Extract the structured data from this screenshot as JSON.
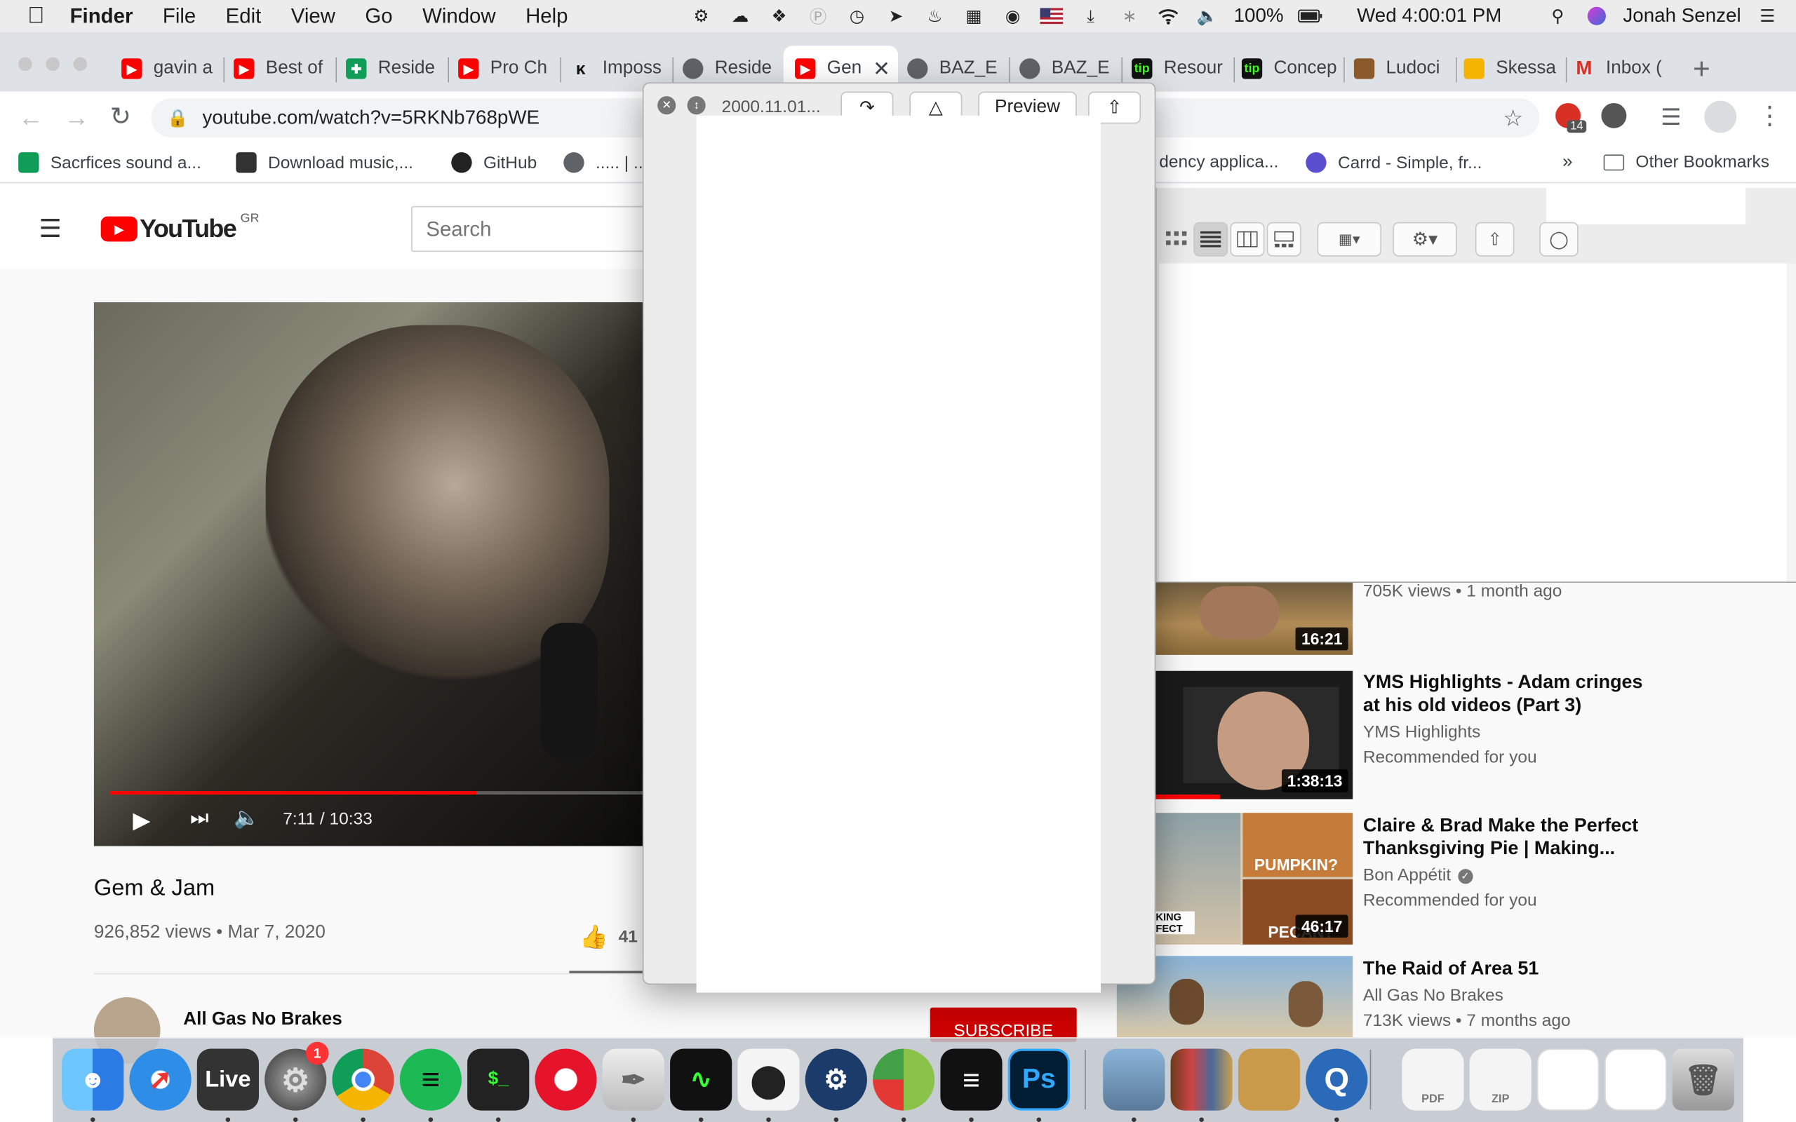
{
  "menubar": {
    "app": "Finder",
    "menus": [
      "File",
      "Edit",
      "View",
      "Go",
      "Window",
      "Help"
    ],
    "battery": "100%",
    "clock": "Wed 4:00:01 PM",
    "user": "Jonah Senzel"
  },
  "browser": {
    "tabs": [
      {
        "title": "gavin a",
        "icon": "youtube"
      },
      {
        "title": "Best of",
        "icon": "youtube"
      },
      {
        "title": "Reside",
        "icon": "sheets"
      },
      {
        "title": "Pro Ch",
        "icon": "youtube"
      },
      {
        "title": "Imposs",
        "icon": "k-logo"
      },
      {
        "title": "Reside",
        "icon": "globe"
      },
      {
        "title": "Gen",
        "icon": "youtube",
        "active": true
      },
      {
        "title": "BAZ_E",
        "icon": "globe"
      },
      {
        "title": "BAZ_E",
        "icon": "globe"
      },
      {
        "title": "Resour",
        "icon": "tip"
      },
      {
        "title": "Concep",
        "icon": "tip"
      },
      {
        "title": "Ludoci",
        "icon": "book"
      },
      {
        "title": "Skessa",
        "icon": "slides"
      },
      {
        "title": "Inbox (",
        "icon": "gmail"
      }
    ],
    "url": "youtube.com/watch?v=5RKNb768pWE",
    "extension_badge": "14",
    "bookmarks": [
      {
        "label": "Sacrfices sound a...",
        "icon": "sheets"
      },
      {
        "label": "Download music,...",
        "icon": "car"
      },
      {
        "label": "GitHub",
        "icon": "github"
      },
      {
        "label": "..... | ..",
        "icon": "globe"
      },
      {
        "label": "dency applica...",
        "icon": ""
      },
      {
        "label": "Carrd - Simple, fr...",
        "icon": "carrd"
      }
    ],
    "more_bookmarks": "»",
    "other_bookmarks": "Other Bookmarks"
  },
  "youtube": {
    "logo": "YouTube",
    "region": "GR",
    "search_placeholder": "Search",
    "player": {
      "time": "7:11 / 10:33",
      "progress": 0.686
    },
    "video_title": "Gem & Jam",
    "stats": "926,852 views • Mar 7, 2020",
    "likes": "41",
    "channel": "All Gas No Brakes",
    "subscribe": "SUBSCRIBE",
    "sidebar": [
      {
        "title": "",
        "channel": "",
        "meta": "705K views • 1 month ago",
        "duration": "16:21"
      },
      {
        "title": "YMS Highlights - Adam cringes at his old videos (Part 3)",
        "channel": "YMS Highlights",
        "meta": "Recommended for you",
        "duration": "1:38:13"
      },
      {
        "title": "Claire & Brad Make the Perfect Thanksgiving Pie | Making...",
        "channel": "Bon Appétit",
        "meta": "Recommended for you",
        "duration": "46:17",
        "thumb_text": "PUMPKIN?",
        "thumb_text2": "PECAN?",
        "thumb_text3": "KING FECT"
      },
      {
        "title": "The Raid of Area 51",
        "channel": "All Gas No Brakes",
        "meta": "713K views • 7 months ago",
        "duration": ""
      }
    ]
  },
  "quicklook": {
    "filename": "2000.11.01...",
    "open_with": "Preview"
  },
  "dock": {
    "apps": [
      "Finder",
      "Safari",
      "Live",
      "System Preferences",
      "Chrome",
      "Spotify",
      "Terminal",
      "Opera",
      "Preview",
      "Activity Monitor",
      "Unity",
      "Steam",
      "Sublime",
      "Text",
      "Photoshop",
      "Preview Photos",
      "Calibre",
      "Books",
      "Dictionary",
      "QuickTime",
      "PDF",
      "ZIP",
      "Documents",
      "Files",
      "Trash"
    ],
    "live_label": "Live",
    "ps_label": "Ps",
    "badge": "1",
    "pdf_label": "PDF",
    "zip_label": "ZIP"
  }
}
